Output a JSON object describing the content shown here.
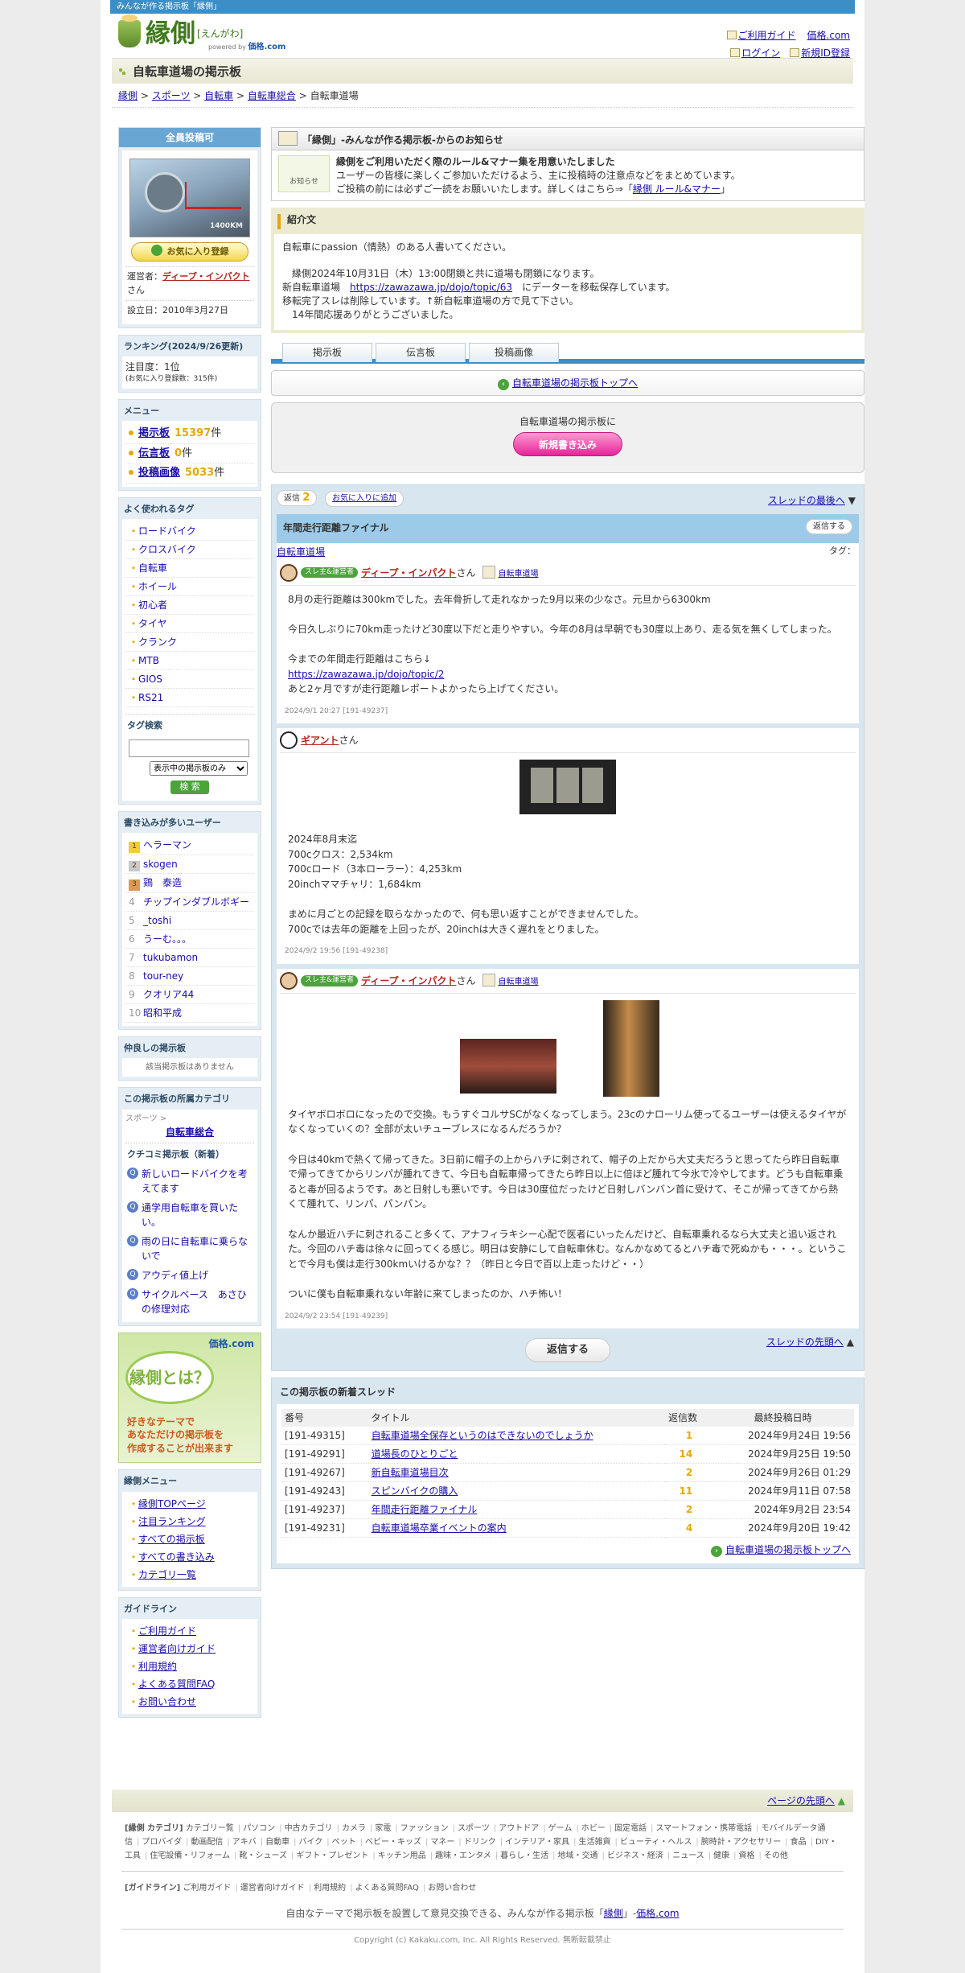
{
  "topbar": "みんなが作る掲示板「縁側」",
  "logo": {
    "main": "縁側",
    "kana": "[えんがわ]",
    "powered": "powered by",
    "brand": "価格.com"
  },
  "header_links": {
    "guide": "ご利用ガイド",
    "kakaku": "価格.com",
    "login": "ログイン",
    "register": "新規ID登録"
  },
  "board_title": "自転車道場の掲示板",
  "breadcrumb": [
    "縁側",
    "スポーツ",
    "自転車",
    "自転車総合",
    "自転車道場"
  ],
  "side": {
    "all_post": "全員投稿可",
    "thumb_km": "1400KM",
    "fav_button": "お気に入り登録",
    "owner_label": "運営者：",
    "owner_name": "ディープ・インパクト",
    "owner_suffix": "さん",
    "founded": "設立日：2010年3月27日",
    "ranking_title": "ランキング(2024/9/26更新)",
    "ranking_attention": "注目度：1位",
    "ranking_fav": "(お気に入り登録数：315件)",
    "menu_title": "メニュー",
    "menu": [
      {
        "label": "掲示板",
        "count": "15397",
        "unit": "件"
      },
      {
        "label": "伝言板",
        "count": "0",
        "unit": "件"
      },
      {
        "label": "投稿画像",
        "count": "5033",
        "unit": "件"
      }
    ],
    "tags_title": "よく使われるタグ",
    "tags": [
      "ロードバイク",
      "クロスバイク",
      "自転車",
      "ホイール",
      "初心者",
      "タイヤ",
      "クランク",
      "MTB",
      "GIOS",
      "RS21"
    ],
    "tagsearch_title": "タグ検索",
    "tagsearch_option": "表示中の掲示板のみ",
    "tagsearch_button": "検 索",
    "users_title": "書き込みが多いユーザー",
    "users": [
      {
        "rank": "1",
        "name": "ヘラーマン"
      },
      {
        "rank": "2",
        "name": "skogen"
      },
      {
        "rank": "3",
        "name": "鶏　泰造"
      },
      {
        "rank": "4",
        "name": "チップインダブルボギー"
      },
      {
        "rank": "5",
        "name": "_toshi"
      },
      {
        "rank": "6",
        "name": "うーむ。。。"
      },
      {
        "rank": "7",
        "name": "tukubamon"
      },
      {
        "rank": "8",
        "name": "tour-ney"
      },
      {
        "rank": "9",
        "name": "クオリア44"
      },
      {
        "rank": "10",
        "name": "昭和平成"
      }
    ],
    "friends_title": "仲良しの掲示板",
    "friends_empty": "該当掲示板はありません",
    "cat_title": "この掲示板の所属カテゴリ",
    "cat_parent": "スポーツ >",
    "cat_name": "自転車総合",
    "kuchikomi_title": "クチコミ掲示板（新着）",
    "kuchikomi": [
      "新しいロードバイクを考えてます",
      "通学用自転車を買いたい。",
      "雨の日に自転車に乗らないで",
      "アウディ値上げ",
      "サイクルベース　あさひ　の修理対応"
    ],
    "guide_brand": "価格.com",
    "guide_bubble": "縁側とは？",
    "guide_text": "好きなテーマで\nあなただけの掲示板を\n作成することが出来ます",
    "engawa_menu_title": "縁側メニュー",
    "engawa_menu": [
      "縁側TOPページ",
      "注目ランキング",
      "すべての掲示板",
      "すべての書き込み",
      "カテゴリ一覧"
    ],
    "guideline_title": "ガイドライン",
    "guideline": [
      "ご利用ガイド",
      "運営者向けガイド",
      "利用規約",
      "よくある質問FAQ",
      "お問い合わせ"
    ]
  },
  "notice": {
    "title": "「縁側」-みんなが作る掲示板-からのお知らせ",
    "icon_label": "お知らせ",
    "headline": "縁側をご利用いただく際のルール&マナー集を用意いたしました",
    "line1": "ユーザーの皆様に楽しくご参加いただけるよう、主に投稿時の注意点などをまとめています。",
    "line2": "ご投稿の前には必ずご一読をお願いいたします。詳しくはこちら⇒「",
    "link": "縁側 ルール&マナー",
    "line2_end": "」"
  },
  "intro": {
    "title": "紹介文",
    "line1": "自転車にpassion（情熱）のある人書いてください。",
    "line2": "　縁側2024年10月31日（木）13:00閉鎖と共に道場も閉鎖になります。",
    "line3a": "新自転車道場　",
    "url": "https://zawazawa.jp/dojo/topic/63",
    "line3b": "　にデーターを移転保存しています。",
    "line4": "移転完了スレは削除しています。↑新自転車道場の方で見て下さい。",
    "line5": "　14年間応援ありがとうございました。"
  },
  "tabs": [
    "掲示板",
    "伝言板",
    "投稿画像"
  ],
  "board_top_link": "自転車道場の掲示板トップへ",
  "post_prompt": "自転車道場の掲示板に",
  "new_post_button": "新規書き込み",
  "thread": {
    "reply_label": "返信",
    "reply_count": "2",
    "fav_add": "お気に入りに追加",
    "to_last": "スレッドの最後へ",
    "title": "年間走行距離ファイナル",
    "reply_button": "返信する",
    "board_link": "自転車道場",
    "tag_label": "タグ：",
    "owner_badge": "スレ主&運営者",
    "san": "さん",
    "posts": [
      {
        "user": "ディープ・インパクト",
        "board": "自転車道場",
        "body1": "8月の走行距離は300kmでした。去年骨折して走れなかった9月以来の少なさ。元旦から6300km\n\n今日久しぶりに70km走ったけど30度以下だと走りやすい。今年の8月は早朝でも30度以上あり、走る気を無くしてしまった。\n\n今までの年間走行距離はこちら↓",
        "url": "https://zawazawa.jp/dojo/topic/2",
        "body2": "\nあと2ヶ月ですが走行距離レポートよかったら上げてください。",
        "date": "2024/9/1 20:27",
        "id": "[191-49237]"
      },
      {
        "user": "ギアント",
        "body1": "2024年8月末迄\n700cクロス：2,534km\n700cロード（3本ローラー）：4,253km\n20inchママチャリ：1,684km\n\nまめに月ごとの記録を取らなかったので、何も思い返すことができませんでした。\n700cでは去年の距離を上回ったが、20inchは大きく遅れをとりました。",
        "date": "2024/9/2 19:56",
        "id": "[191-49238]"
      },
      {
        "user": "ディープ・インパクト",
        "board": "自転車道場",
        "body1": "タイヤボロボロになったので交換。もうすぐコルサSCがなくなってしまう。23cのナローリム使ってるユーザーは使えるタイヤがなくなっていくの？全部が太いチューブレスになるんだろうか？\n\n今日は40kmで熱くて帰ってきた。3日前に帽子の上からハチに刺されて、帽子の上だから大丈夫だろうと思ってたら昨日自転車で帰ってきてからリンパが腫れてきて、今日も自転車帰ってきたら昨日以上に倍ほど腫れて今氷で冷やしてます。どうも自転車乗ると毒が回るようです。あと日射しも悪いです。今日は30度位だったけど日射しバンバン首に受けて、そこが帰ってきてから熱くて腫れて、リンパ、パンパン。\n\nなんか最近ハチに刺されること多くて、アナフィラキシー心配で医者にいったんだけど、自転車乗れるなら大丈夫と追い返された。今回のハチ毒は徐々に回ってくる感じ。明日は安静にして自転車休む。なんかなめてるとハチ毒で死ぬかも・・・。ということで今月も僕は走行300kmいけるかな？？（昨日と今日で百以上走ったけど・・）\n\nついに僕も自転車乗れない年齢に来てしまったのか、ハチ怖い！",
        "date": "2024/9/2 23:54",
        "id": "[191-49239]"
      }
    ],
    "bottom_reply": "返信する",
    "to_top": "スレッドの先頭へ"
  },
  "new_threads": {
    "title": "この掲示板の新着スレッド",
    "columns": [
      "番号",
      "タイトル",
      "返信数",
      "最終投稿日時"
    ],
    "rows": [
      [
        "[191-49315]",
        "自転車道場全保存というのはできないのでしょうか",
        "1",
        "2024年9月24日 19:56"
      ],
      [
        "[191-49291]",
        "道場長のひとりごと",
        "14",
        "2024年9月25日 19:50"
      ],
      [
        "[191-49267]",
        "新自転車道場目次",
        "2",
        "2024年9月26日 01:29"
      ],
      [
        "[191-49243]",
        "スピンバイクの購入",
        "11",
        "2024年9月11日 07:58"
      ],
      [
        "[191-49237]",
        "年間走行距離ファイナル",
        "2",
        "2024年9月2日 23:54"
      ],
      [
        "[191-49231]",
        "自転車道場卒業イベントの案内",
        "4",
        "2024年9月20日 19:42"
      ]
    ],
    "bottom_link": "自転車道場の掲示板トップへ"
  },
  "footer": {
    "page_top": "ページの先頭へ",
    "cat_label": "[縁側 カテゴリ]",
    "categories": [
      "カテゴリー覧",
      "パソコン",
      "中古カテゴリ",
      "カメラ",
      "家電",
      "ファッション",
      "スポーツ",
      "アウトドア",
      "ゲーム",
      "ホビー",
      "固定電話",
      "スマートフォン・携帯電話",
      "モバイルデータ通信",
      "プロバイダ",
      "動画配信",
      "アキバ",
      "自動車",
      "バイク",
      "ペット",
      "ベビー・キッズ",
      "マネー",
      "ドリンク",
      "インテリア・家具",
      "生活雑貨",
      "ビューティ・ヘルス",
      "腕時計・アクセサリー",
      "食品",
      "DIY・工具",
      "住宅設備・リフォーム",
      "靴・シューズ",
      "ギフト・プレゼント",
      "キッチン用品",
      "趣味・エンタメ",
      "暮らし・生活",
      "地域・交通",
      "ビジネス・経済",
      "ニュース",
      "健康",
      "資格",
      "その他"
    ],
    "guide_label": "[ガイドライン]",
    "guides": [
      "ご利用ガイド",
      "運営者向けガイド",
      "利用規約",
      "よくある質問FAQ",
      "お問い合わせ"
    ],
    "tagline": "自由なテーマで掲示板を設置して意見交換できる、みんなが作る掲示板「",
    "tagline_link": "縁側",
    "tagline_mid": "」-",
    "tagline_kakaku": "価格.com",
    "copyright": "Copyright (c) Kakaku.com, Inc. All Rights Reserved. 無断転載禁止"
  }
}
